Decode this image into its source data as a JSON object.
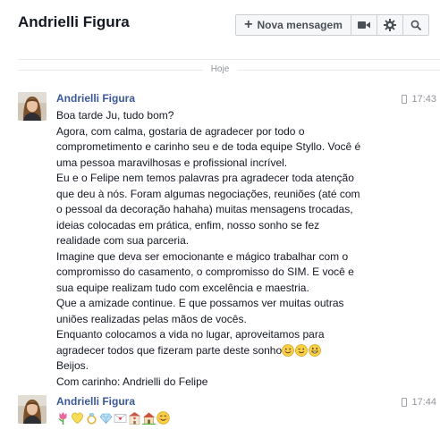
{
  "header": {
    "title": "Andrielli Figura",
    "new_message_label": "Nova mensagem",
    "icons": [
      "video-call-icon",
      "gear-icon",
      "search-icon"
    ]
  },
  "day_separator": "Hoje",
  "messages": [
    {
      "sender": "Andrielli Figura",
      "time": "17:43",
      "lines": [
        "Boa tarde Ju, tudo bom?",
        "Agora, com calma, gostaria de agradecer por todo o",
        "comprometimento e carinho seu e de toda equipe Styllo. Você é",
        "uma pessoa maravilhosas e profissional incrível.",
        "Eu e o Felipe nem temos palavras pra agradecer toda atenção",
        "que deu à nós. Foram algumas negociações, reuniões (até com",
        "o pessoal da decoração hahaha) muitas mensagens trocadas,",
        "ideias colocadas em prática, enfim, nosso sonho se fez",
        "realidade com sua parceria.",
        "Imagine que deva ser emocionante e mágico trabalhar com o",
        "compromisso do casamento, o compromisso do SIM. E você e",
        "sua equipe realizam tudo com excelência e maestria.",
        "Que a amizade continue. E que possamos ver muitas outras",
        "uniões realizadas pelas mãos de vocês.",
        "Enquanto colocamos a vida no lugar, aproveitamos para",
        "agradecer todos que fizeram parte deste sonho",
        " Beijos.",
        "Com carinho: Andrielli do Felipe"
      ],
      "emojis": [
        "smiling-face-icon",
        "wink-face-icon",
        "grinning-face-icon"
      ]
    },
    {
      "sender": "Andrielli Figura",
      "time": "17:44",
      "emojis": [
        "tulip-icon",
        "yellow-heart-icon",
        "ring-icon",
        "gem-icon",
        "love-letter-icon",
        "wedding-icon",
        "house-icon",
        "blushing-face-icon"
      ]
    }
  ],
  "colors": {
    "sender_name": "#3b5998",
    "muted_text": "#90949c",
    "separator": "#e9ebee",
    "button_bg": "#f6f7f9",
    "button_border": "#ccd0d5"
  }
}
